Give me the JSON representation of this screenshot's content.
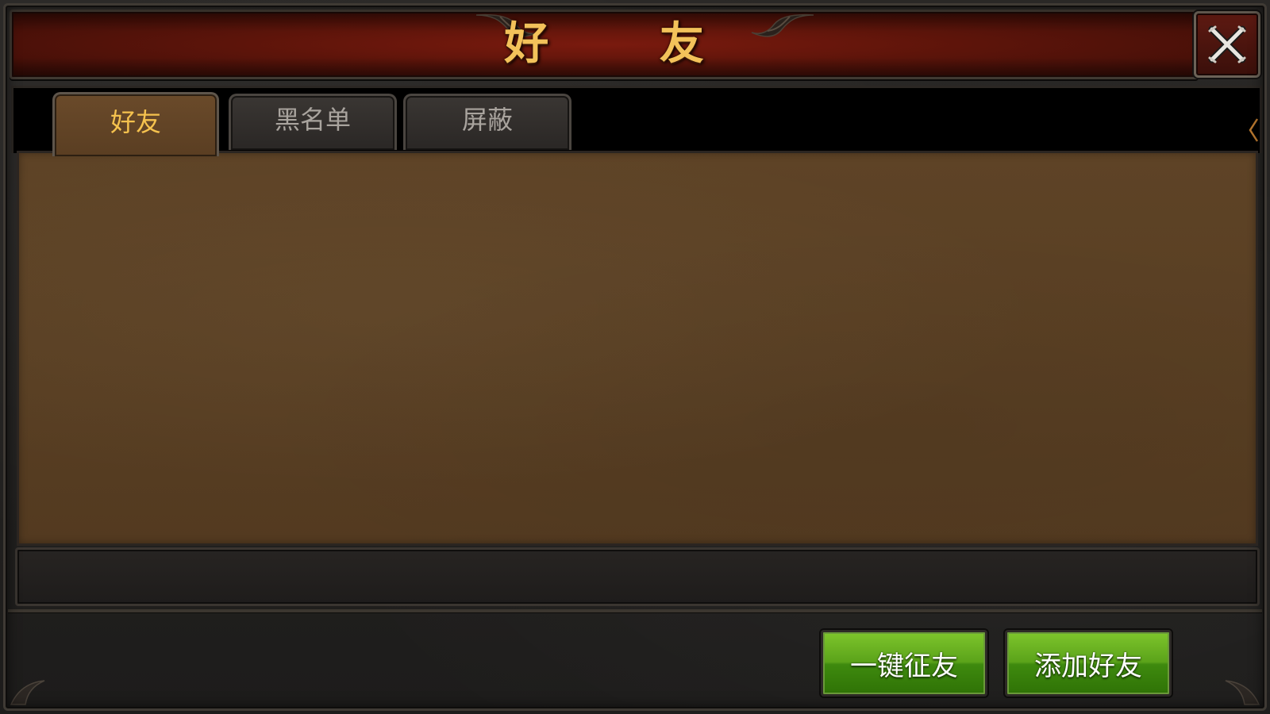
{
  "window": {
    "title": "好 友",
    "close_icon": "close-x-icon"
  },
  "tabs": [
    {
      "label": "好友",
      "active": true
    },
    {
      "label": "黑名单",
      "active": false
    },
    {
      "label": "屏蔽",
      "active": false
    }
  ],
  "friends_list": {
    "items": []
  },
  "actions": {
    "recruit_label": "一键征友",
    "add_friend_label": "添加好友"
  },
  "colors": {
    "title_gold": "#f3c25a",
    "active_tab_text": "#f5c24e",
    "inactive_tab_text": "#a9a49e",
    "button_green": "#5ba31a",
    "panel_brown": "#593f23",
    "title_red": "#5c140a"
  }
}
